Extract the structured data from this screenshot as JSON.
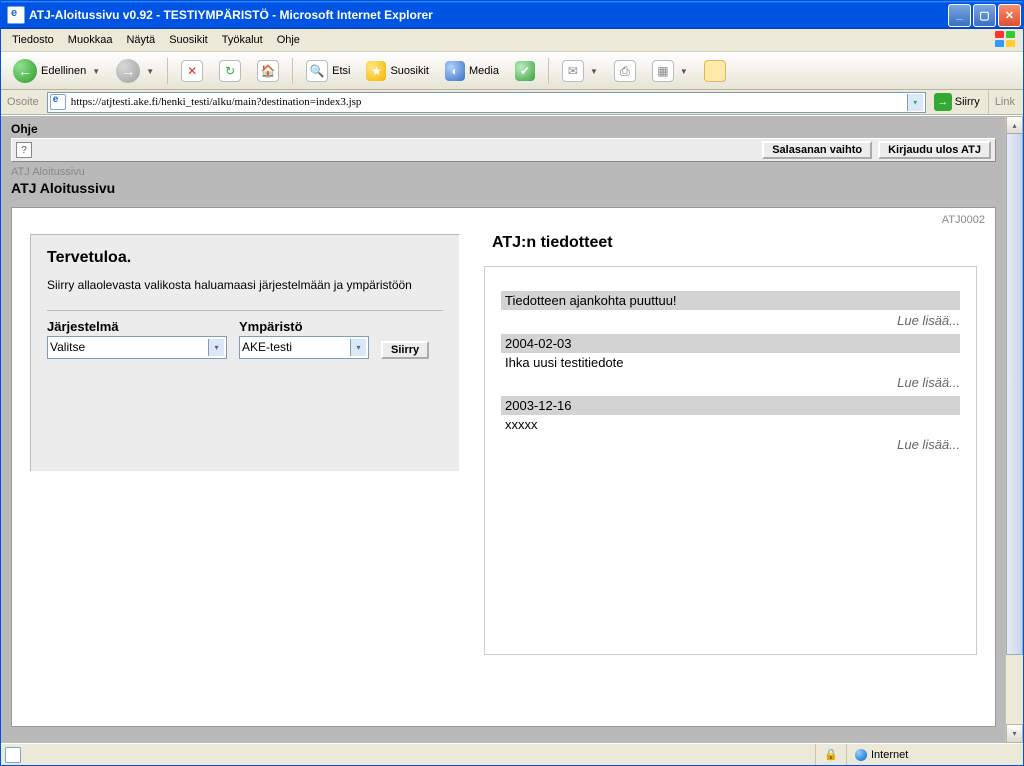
{
  "window": {
    "title": "ATJ-Aloitussivu v0.92 - TESTIYMPÄRISTÖ - Microsoft Internet Explorer"
  },
  "menu": {
    "file": "Tiedosto",
    "edit": "Muokkaa",
    "view": "Näytä",
    "favorites": "Suosikit",
    "tools": "Työkalut",
    "help": "Ohje"
  },
  "toolbar": {
    "back": "Edellinen",
    "search": "Etsi",
    "favorites": "Suosikit",
    "media": "Media"
  },
  "address": {
    "label": "Osoite",
    "url": "https://atjtesti.ake.fi/henki_testi/alku/main?destination=index3.jsp",
    "go": "Siirry",
    "links": "Link"
  },
  "app": {
    "ohje": "Ohje",
    "help_symbol": "?",
    "btn_password": "Salasanan vaihto",
    "btn_logout": "Kirjaudu ulos ATJ",
    "breadcrumb": "ATJ Aloitussivu",
    "page_title": "ATJ Aloitussivu",
    "page_code": "ATJ0002"
  },
  "welcome": {
    "title": "Tervetuloa.",
    "text": "Siirry allaolevasta valikosta haluamaasi järjestelmään ja ympäristöön",
    "system_label": "Järjestelmä",
    "system_value": "Valitse",
    "env_label": "Ympäristö",
    "env_value": "AKE-testi",
    "go": "Siirry"
  },
  "news": {
    "title": "ATJ:n tiedotteet",
    "read_more": "Lue lisää...",
    "items": [
      {
        "header": "Tiedotteen ajankohta puuttuu!",
        "body": ""
      },
      {
        "header": "2004-02-03",
        "body": "Ihka uusi testitiedote"
      },
      {
        "header": "2003-12-16",
        "body": "xxxxx"
      }
    ]
  },
  "status": {
    "zone": "Internet"
  }
}
